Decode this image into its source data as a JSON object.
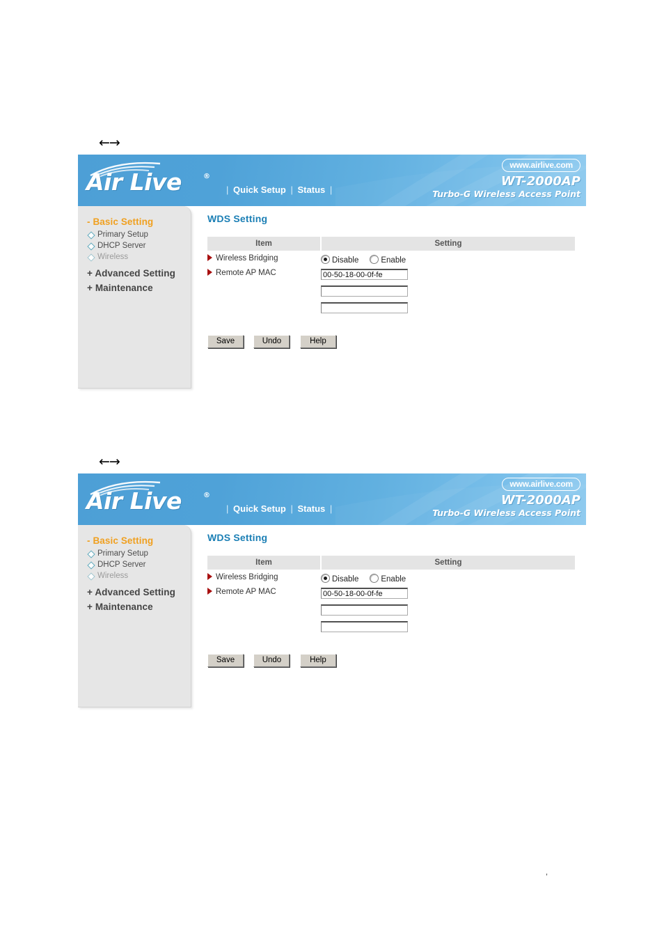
{
  "page": {
    "arrow_marker": "←→",
    "footer_mark": ","
  },
  "banner": {
    "brand_name": "Air Live",
    "brand_reg": "®",
    "nav": {
      "sep": "|",
      "quick_setup": "Quick Setup",
      "status": "Status"
    },
    "url_pill": "www.airlive.com",
    "model": "WT-2000AP",
    "tagline": "Turbo-G Wireless Access Point"
  },
  "sidebar": {
    "basic_setting": "- Basic Setting",
    "sub_items": [
      {
        "label": "Primary Setup",
        "active": false
      },
      {
        "label": "DHCP Server",
        "active": false
      },
      {
        "label": "Wireless",
        "active": true
      }
    ],
    "advanced_setting": "+ Advanced Setting",
    "maintenance": "+ Maintenance"
  },
  "content": {
    "title": "WDS Setting",
    "table": {
      "headers": {
        "item": "Item",
        "setting": "Setting"
      },
      "rows": [
        {
          "label": "Wireless Bridging",
          "type": "radio",
          "options": [
            {
              "label": "Disable",
              "selected": true
            },
            {
              "label": "Enable",
              "selected": false
            }
          ]
        },
        {
          "label": "Remote AP MAC",
          "type": "text",
          "values": [
            "00-50-18-00-0f-fe",
            "",
            ""
          ]
        }
      ]
    },
    "buttons": {
      "save": "Save",
      "undo": "Undo",
      "help": "Help"
    }
  },
  "colors": {
    "brand_blue": "#4d9fd6",
    "title_blue": "#1b7fb5",
    "nav_orange": "#f0a020",
    "bullet_red": "#a81010",
    "sidebar_bg": "#e6e6e6",
    "table_header_bg": "#e4e4e4",
    "button_face": "#d4d0c8"
  }
}
